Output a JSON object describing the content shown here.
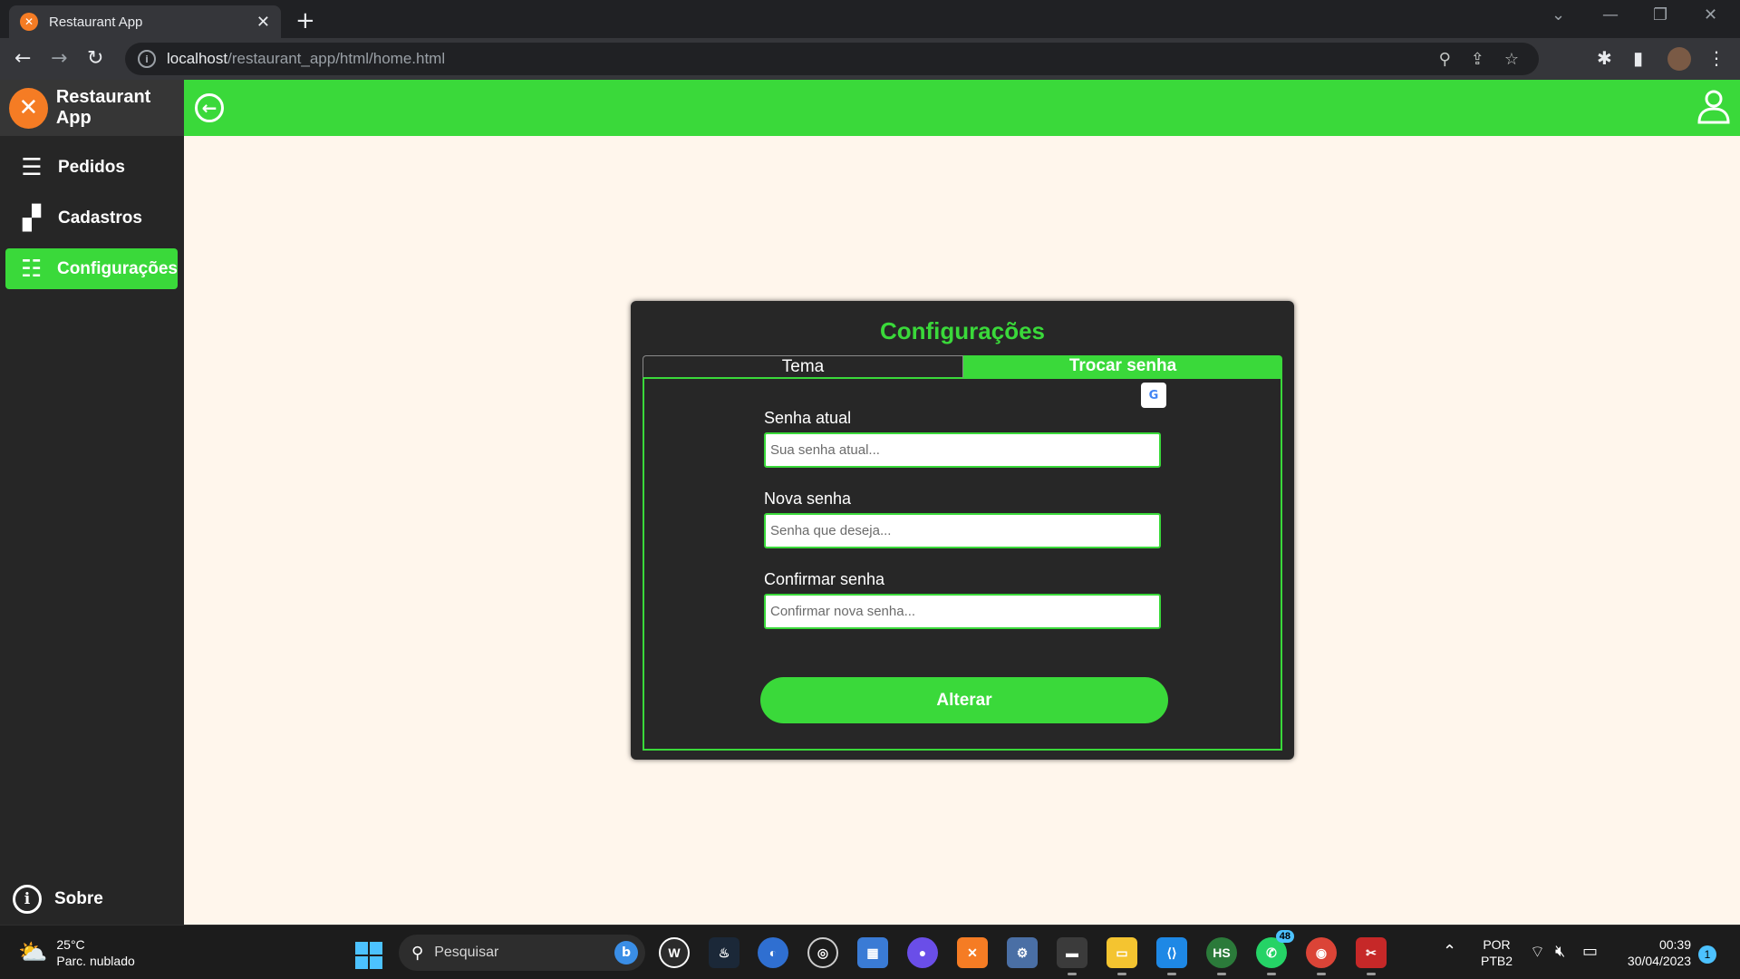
{
  "browser": {
    "tab_title": "Restaurant App",
    "url_host": "localhost",
    "url_path": "/restaurant_app/html/home.html"
  },
  "app": {
    "brand_name": "Restaurant App",
    "nav": [
      {
        "label": "Pedidos",
        "icon": "list-icon"
      },
      {
        "label": "Cadastros",
        "icon": "boxes-icon"
      },
      {
        "label": "Configurações",
        "icon": "sliders-icon",
        "active": true
      }
    ],
    "sobre_label": "Sobre",
    "accent_color": "#3ad93a"
  },
  "settings": {
    "title": "Configurações",
    "tabs": [
      {
        "label": "Tema",
        "active": false
      },
      {
        "label": "Trocar senha",
        "active": true
      }
    ],
    "fields": [
      {
        "label": "Senha atual",
        "placeholder": "Sua senha atual..."
      },
      {
        "label": "Nova senha",
        "placeholder": "Senha que deseja..."
      },
      {
        "label": "Confirmar senha",
        "placeholder": "Confirmar nova senha..."
      }
    ],
    "submit_label": "Alterar"
  },
  "taskbar": {
    "weather_temp": "25°C",
    "weather_desc": "Parc. nublado",
    "search_placeholder": "Pesquisar",
    "whatsapp_badge": "48",
    "lang_line1": "POR",
    "lang_line2": "PTB2",
    "time": "00:39",
    "date": "30/04/2023",
    "notification_count": "1"
  }
}
